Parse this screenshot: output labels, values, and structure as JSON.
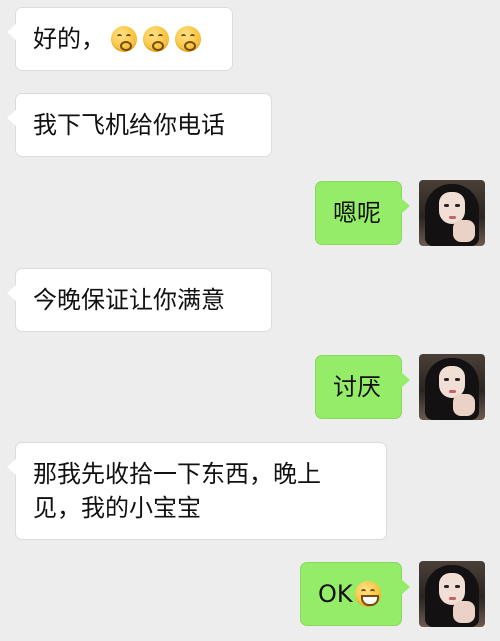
{
  "chat": {
    "messages": [
      {
        "side": "left",
        "text": "好的，",
        "emojis": [
          "kiss-face-emoji",
          "kiss-face-emoji",
          "kiss-face-emoji"
        ]
      },
      {
        "side": "left",
        "text": "我下飞机给你电话"
      },
      {
        "side": "right",
        "text": "嗯呢"
      },
      {
        "side": "left",
        "text": "今晚保证让你满意"
      },
      {
        "side": "right",
        "text": "讨厌"
      },
      {
        "side": "left",
        "text": "那我先收拾一下东西，晚上\n见，我的小宝宝"
      },
      {
        "side": "right",
        "text": "OK",
        "emojis": [
          "grin-face-emoji"
        ]
      }
    ]
  },
  "colors": {
    "background": "#ededed",
    "incoming_bubble": "#ffffff",
    "outgoing_bubble": "#95ec69"
  }
}
